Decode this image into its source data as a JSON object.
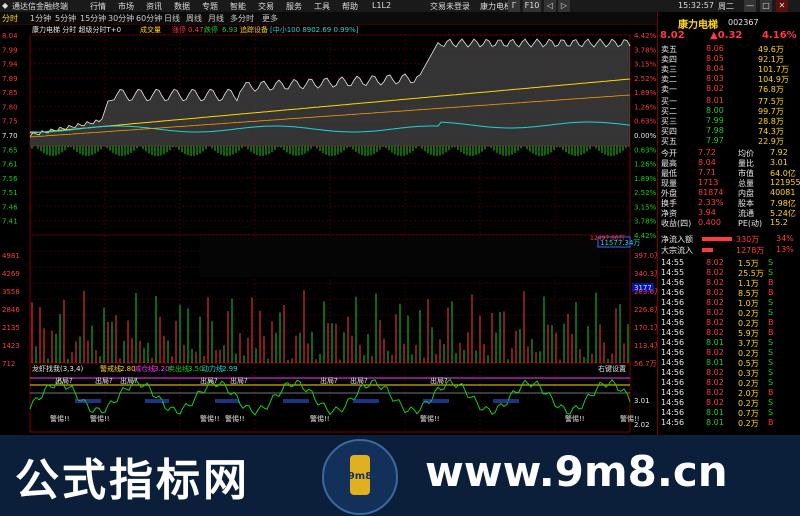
{
  "titlebar": {
    "app_name": "通达信金融终端",
    "menus": [
      "行情",
      "市场",
      "资讯",
      "数据",
      "专题",
      "智能",
      "交易",
      "服务",
      "工具",
      "帮助",
      "L1L2"
    ],
    "alert_red": "交易未登录",
    "stock_name_red": "康力电梯",
    "time": "15:32:57",
    "weekday": "周二",
    "win_buttons": [
      "Γ",
      "F10",
      "◁",
      "▷",
      "—",
      "□",
      "✕"
    ]
  },
  "toolbar": {
    "tabs": [
      "分时",
      "1分钟",
      "5分钟",
      "15分钟",
      "30分钟",
      "60分钟",
      "日线",
      "周线",
      "月线",
      "多分时",
      "更多"
    ]
  },
  "chart_info": {
    "title": "康力电梯 分时 超级分时T+0",
    "vol_label": "成交量",
    "vol_value": "0.47",
    "up_label": "涨停",
    "up_value": "0.47",
    "down_label": "跌停",
    "down_value": "6.93",
    "extra": "追踪设备",
    "extra2": "[中小100 8902.69 0.99%]",
    "price_labels_left": [
      "8.04",
      "7.99",
      "7.94",
      "7.89",
      "7.85",
      "7.80",
      "7.75",
      "7.70",
      "7.65",
      "7.61",
      "7.56",
      "7.51",
      "7.46",
      "7.41",
      "4981",
      "4269",
      "3558",
      "2846",
      "2135",
      "1423",
      "712"
    ],
    "pct_labels_right": [
      "4.42%",
      "3.78%",
      "3.15%",
      "2.52%",
      "1.89%",
      "1.26%",
      "0.63%",
      "0.00%",
      "0.63%",
      "1.26%",
      "1.89%",
      "2.52%",
      "3.15%",
      "3.78%",
      "4.42%"
    ],
    "vol_labels_right": [
      "397.0万",
      "340.3万",
      "283.6万",
      "226.8万",
      "170.1万",
      "113.4万",
      "56.7万"
    ],
    "blue_tag": "11577.34万",
    "red_tag": "12497.60万",
    "tag_3177": "3177",
    "tags_top": [
      "佳",
      "出",
      "佳",
      "出",
      "出",
      "出"
    ],
    "indicator_title": "龙虾找我(3,3,4)",
    "ind_a_label": "警戒线",
    "ind_a_value": "2.80",
    "ind_b_label": "减仓线",
    "ind_b_value": "3.20",
    "ind_c_label": "卖出线",
    "ind_c_value": "3.50",
    "ind_d_label": "动力线",
    "ind_d_value": "2.99",
    "ind_setting": "右键设置",
    "ind_right_val1": "3.01",
    "ind_right_val2": "2.02",
    "ind_annot_out": "出局?",
    "ind_annot_warn": "警惕!!"
  },
  "quote": {
    "name": "康力电梯",
    "code": "002367",
    "price": "8.02",
    "change": "▲0.32",
    "pct": "4.16%",
    "asks": [
      {
        "label": "卖五",
        "price": "8.06",
        "vol": "49.6万"
      },
      {
        "label": "卖四",
        "price": "8.05",
        "vol": "92.1万"
      },
      {
        "label": "卖三",
        "price": "8.04",
        "vol": "101.7万"
      },
      {
        "label": "卖二",
        "price": "8.03",
        "vol": "104.9万"
      },
      {
        "label": "卖一",
        "price": "8.02",
        "vol": "76.8万"
      }
    ],
    "bids": [
      {
        "label": "买一",
        "price": "8.01",
        "vol": "77.5万"
      },
      {
        "label": "买二",
        "price": "8.00",
        "vol": "99.7万"
      },
      {
        "label": "买三",
        "price": "7.99",
        "vol": "28.8万"
      },
      {
        "label": "买四",
        "price": "7.98",
        "vol": "74.3万"
      },
      {
        "label": "买五",
        "price": "7.97",
        "vol": "22.9万"
      }
    ],
    "stats": [
      {
        "l1": "今开",
        "v1": "7.72",
        "l2": "均价",
        "v2": "7.92"
      },
      {
        "l1": "最高",
        "v1": "8.04",
        "l2": "量比",
        "v2": "3.01"
      },
      {
        "l1": "最低",
        "v1": "7.71",
        "l2": "市值",
        "v2": "64.0亿"
      },
      {
        "l1": "现量",
        "v1": "1713",
        "l2": "总量",
        "v2": "121955"
      },
      {
        "l1": "外盘",
        "v1": "81874",
        "l2": "内盘",
        "v2": "40081"
      },
      {
        "l1": "换手",
        "v1": "2.33%",
        "l2": "股本",
        "v2": "7.98亿"
      },
      {
        "l1": "净资",
        "v1": "3.94",
        "l2": "流通",
        "v2": "5.24亿"
      },
      {
        "l1": "收益(四)",
        "v1": "0.400",
        "l2": "PE(动)",
        "v2": "15.2"
      }
    ],
    "flow": [
      {
        "label": "净流入额",
        "value": "330万",
        "pct": "34%",
        "fill": 0.34
      },
      {
        "label": "大宗流入",
        "value": "1278万",
        "pct": "13%",
        "fill": 0.13
      }
    ],
    "ticks": [
      [
        "14:55",
        "8.02",
        "1.5万",
        "S"
      ],
      [
        "14:55",
        "8.02",
        "25.5万",
        "S"
      ],
      [
        "14:56",
        "8.02",
        "1.1万",
        "B"
      ],
      [
        "14:56",
        "8.02",
        "8.5万",
        "B"
      ],
      [
        "14:56",
        "8.02",
        "1.0万",
        "S"
      ],
      [
        "14:56",
        "8.02",
        "0.2万",
        "S"
      ],
      [
        "14:56",
        "8.02",
        "0.2万",
        "B"
      ],
      [
        "14:56",
        "8.02",
        "5.9万",
        "B"
      ],
      [
        "14:56",
        "8.01",
        "3.7万",
        "S"
      ],
      [
        "14:56",
        "8.02",
        "0.2万",
        "S"
      ],
      [
        "14:56",
        "8.01",
        "0.5万",
        "S"
      ],
      [
        "14:56",
        "8.02",
        "0.3万",
        "S"
      ],
      [
        "14:56",
        "8.02",
        "0.2万",
        "S"
      ],
      [
        "14:56",
        "8.02",
        "2.0万",
        "B"
      ],
      [
        "14:56",
        "8.02",
        "0.2万",
        "S"
      ],
      [
        "14:56",
        "8.01",
        "0.7万",
        "S"
      ],
      [
        "14:56",
        "8.01",
        "0.2万",
        "B"
      ]
    ]
  },
  "banner": {
    "brand": "公式指标网",
    "url": "www.9m8.cn",
    "logo_text": "9m8"
  }
}
